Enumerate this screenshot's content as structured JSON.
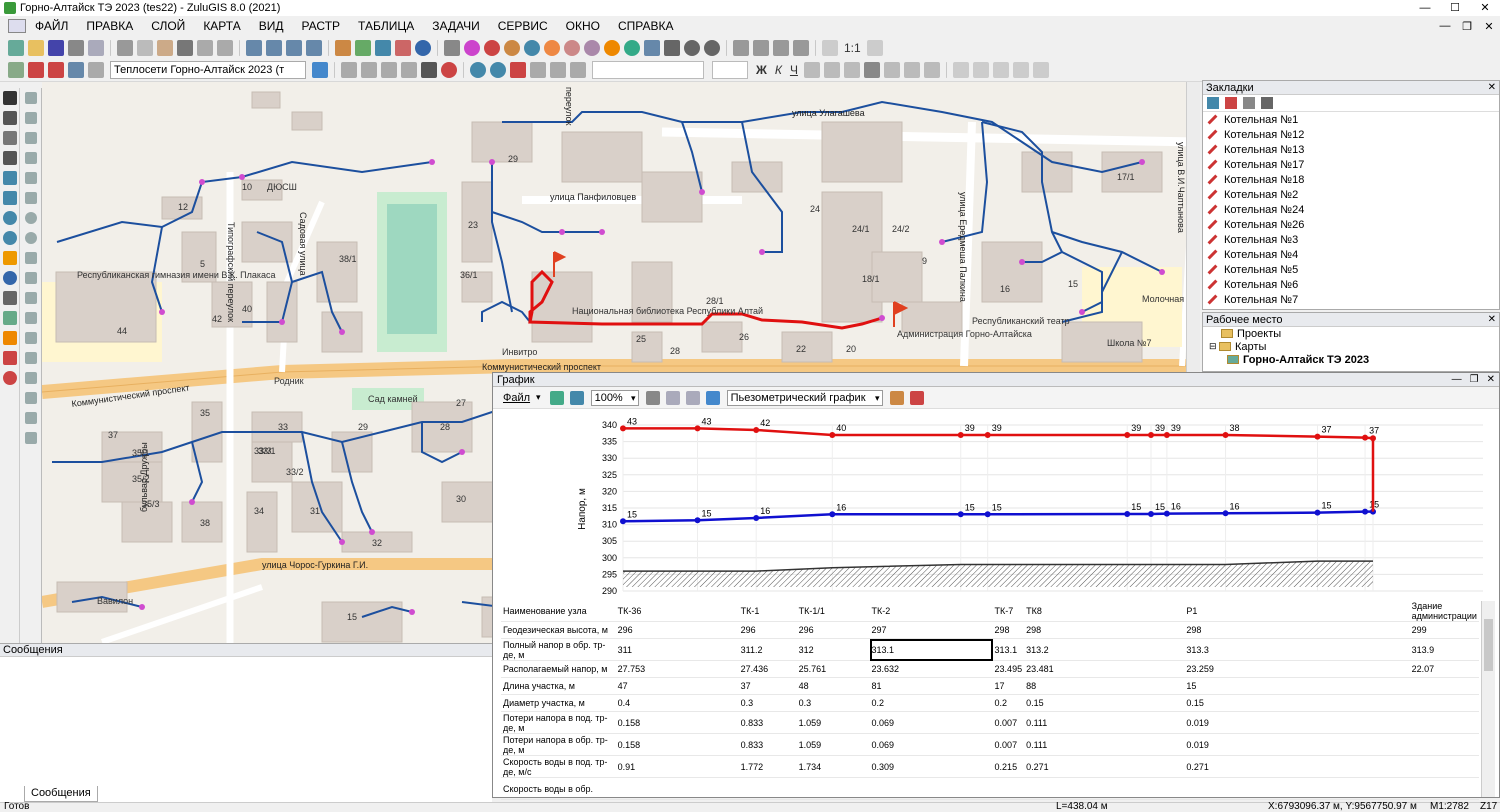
{
  "window": {
    "title": "Горно-Алтайск ТЭ 2023 (tes22) - ZuluGIS 8.0 (2021)"
  },
  "menu": [
    "ФАЙЛ",
    "ПРАВКА",
    "СЛОЙ",
    "КАРТА",
    "ВИД",
    "РАСТР",
    "ТАБЛИЦА",
    "ЗАДАЧИ",
    "СЕРВИС",
    "ОКНО",
    "СПРАВКА"
  ],
  "toolbar": {
    "layer_combo": "Теплосети Горно-Алтайск 2023 (т",
    "zoom_text": "1:1",
    "font_btns": [
      "Ж",
      "К",
      "Ч"
    ]
  },
  "map": {
    "streets": [
      "улица Улагашева",
      "улица Панфиловцев",
      "Коммунистический проспект",
      "Типографский переулок",
      "Садовая улица",
      "бульвар Дружбы",
      "улица Чорос-Гуркина Г.И.",
      "улица Ередмеша Палкина",
      "улица В.И.Чаптынова",
      "переулок"
    ],
    "places": [
      "Республиканская гимназия имени В.К. Плакаса",
      "ДЮСШ",
      "Национальная библиотека Республики Алтай",
      "Администрация Горно-Алтайска",
      "Республиканский театр",
      "Молочная кухня",
      "Школа №7",
      "Инвитро",
      "Родник",
      "Сад камней",
      "Вавилон"
    ],
    "houses": [
      "12",
      "10",
      "5",
      "44",
      "42",
      "40",
      "38/1",
      "23",
      "29",
      "26",
      "25",
      "32",
      "47",
      "36/1",
      "28/1",
      "28",
      "26",
      "22",
      "20",
      "18/1",
      "24/1",
      "24/2",
      "24",
      "16",
      "15",
      "17/1",
      "9",
      "35",
      "37",
      "35/1",
      "35/2",
      "35/3",
      "38",
      "33",
      "33/1",
      "33/2",
      "33/3",
      "34",
      "31",
      "32",
      "29",
      "28",
      "27",
      "30",
      "15"
    ]
  },
  "bookmarks": {
    "title": "Закладки",
    "items": [
      "Котельная №1",
      "Котельная №12",
      "Котельная №13",
      "Котельная №17",
      "Котельная №18",
      "Котельная №2",
      "Котельная №24",
      "Котельная №26",
      "Котельная №3",
      "Котельная №4",
      "Котельная №5",
      "Котельная №6",
      "Котельная №7"
    ]
  },
  "workspace": {
    "title": "Рабочее место",
    "items": [
      "Проекты",
      "Карты",
      "Горно-Алтайск ТЭ 2023"
    ]
  },
  "messages": {
    "title": "Сообщения",
    "tab": "Сообщения"
  },
  "status": {
    "ready": "Готов",
    "length": "L=438.04 м",
    "coords": "X:6793096.37 м, Y:9567750.97 м",
    "scale": "M1:2782",
    "zoom": "Z17"
  },
  "graph": {
    "title": "График",
    "file_menu": "Файл",
    "zoom": "100%",
    "graph_type": "Пьезометрический график",
    "yaxis_label": "Напор, м",
    "columns": [
      "ТК-36",
      "ТК-1",
      "ТК-1/1",
      "ТК-2",
      "ТК-7",
      "ТК8",
      "Р1",
      "Здание администрации"
    ],
    "rows": [
      {
        "name": "Наименование узла",
        "values": [
          "ТК-36",
          "ТК-1",
          "ТК-1/1",
          "ТК-2",
          "ТК-7",
          "ТК8",
          "Р1",
          "Здание администрации"
        ]
      },
      {
        "name": "Геодезическая высота, м",
        "values": [
          "296",
          "296",
          "296",
          "297",
          "298",
          "298",
          "298",
          "299"
        ]
      },
      {
        "name": "Полный напор в обр. тр-де, м",
        "values": [
          "311",
          "311.2",
          "312",
          "313.1",
          "313.1",
          "313.2",
          "313.3",
          "313.9"
        ]
      },
      {
        "name": "Располагаемый напор, м",
        "values": [
          "27.753",
          "27.436",
          "25.761",
          "23.632",
          "23.495",
          "23.481",
          "23.259",
          "22.07"
        ]
      },
      {
        "name": "Длина участка, м",
        "values": [
          "47",
          "37",
          "48",
          "81",
          "17",
          "88",
          "15",
          ""
        ]
      },
      {
        "name": "Диаметр участка, м",
        "values": [
          "0.4",
          "0.3",
          "0.3",
          "0.2",
          "0.2",
          "0.15",
          "0.15",
          ""
        ]
      },
      {
        "name": "Потери напора в под. тр-де, м",
        "values": [
          "0.158",
          "0.833",
          "1.059",
          "0.069",
          "0.007",
          "0.111",
          "0.019",
          ""
        ]
      },
      {
        "name": "Потери напора в обр. тр-де, м",
        "values": [
          "0.158",
          "0.833",
          "1.059",
          "0.069",
          "0.007",
          "0.111",
          "0.019",
          ""
        ]
      },
      {
        "name": "Скорость воды в под. тр-де, м/с",
        "values": [
          "0.91",
          "1.772",
          "1.734",
          "0.309",
          "0.215",
          "0.271",
          "0.271",
          ""
        ]
      },
      {
        "name": "Скорость воды в обр.",
        "values": [
          "",
          "",
          "",
          "",
          "",
          "",
          "",
          ""
        ]
      }
    ]
  },
  "chart_data": {
    "type": "line",
    "ylabel": "Напор, м",
    "ylim": [
      290,
      340
    ],
    "yticks": [
      290,
      295,
      300,
      305,
      310,
      315,
      320,
      325,
      330,
      335,
      340
    ],
    "x": [
      0,
      47,
      84,
      132,
      213,
      230,
      318,
      333,
      343,
      380,
      438,
      468,
      473
    ],
    "series": [
      {
        "color": "#e01010",
        "values": [
          339,
          339,
          338.5,
          337,
          337,
          337,
          337,
          337,
          337,
          337,
          336.5,
          336.2,
          336
        ],
        "labels": [
          "43",
          "43",
          "42",
          "40",
          "39",
          "39",
          "39",
          "39",
          "39",
          "38",
          "37",
          "37",
          ""
        ]
      },
      {
        "color": "#1010d0",
        "values": [
          311,
          311.3,
          312,
          313.1,
          313.1,
          313.1,
          313.2,
          313.2,
          313.3,
          313.4,
          313.6,
          313.9,
          313.9
        ],
        "labels": [
          "15",
          "15",
          "16",
          "16",
          "15",
          "15",
          "15",
          "15",
          "16",
          "16",
          "15",
          "15",
          ""
        ]
      },
      {
        "color": "#333333",
        "values": [
          296,
          296,
          296,
          297,
          298,
          298,
          298,
          298,
          298,
          298,
          299,
          299,
          299
        ]
      }
    ],
    "grid": true
  }
}
